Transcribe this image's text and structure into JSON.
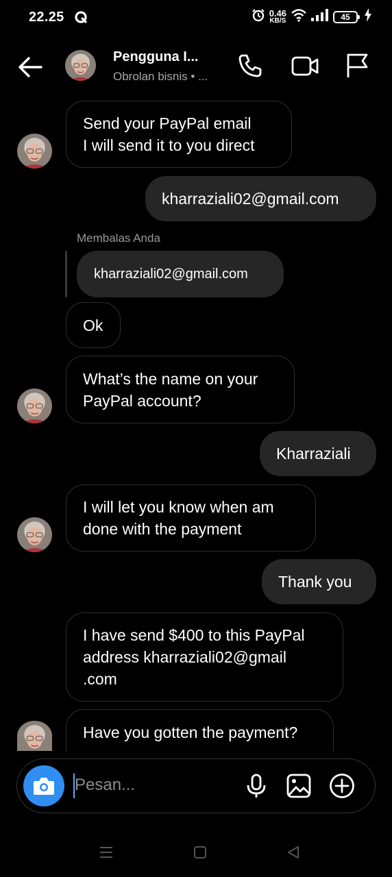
{
  "status_bar": {
    "time": "22.25",
    "net_speed_value": "0.46",
    "net_speed_unit": "KB/S",
    "battery": "45",
    "icons": [
      "q-app-icon",
      "alarm-icon",
      "wifi-icon",
      "signal-icon",
      "battery-icon",
      "charging-icon"
    ]
  },
  "header": {
    "contact_name": "Pengguna I...",
    "subtitle": "Obrolan bisnis • ...",
    "icons": [
      "back-arrow-icon",
      "phone-icon",
      "video-icon",
      "flag-icon"
    ]
  },
  "messages": [
    {
      "from": "them",
      "lines": [
        "Send your PayPal email",
        "I will send it to you direct"
      ]
    },
    {
      "from": "me",
      "lines": [
        "kharraziali02@gmail.com"
      ]
    },
    {
      "from": "them",
      "reply_label": "Membalas Anda",
      "reply_quote": "kharraziali02@gmail.com",
      "lines": [
        "Ok"
      ]
    },
    {
      "from": "them",
      "lines": [
        "What’s the name on your",
        "PayPal account?"
      ]
    },
    {
      "from": "me",
      "lines": [
        "Kharraziali"
      ]
    },
    {
      "from": "them",
      "lines": [
        "I will let you know when am",
        "done with the payment"
      ]
    },
    {
      "from": "me",
      "lines": [
        "Thank you"
      ]
    },
    {
      "from": "them",
      "lines": [
        "I have send $400 to this PayPal",
        "address kharraziali02@gmail",
        ".com"
      ]
    },
    {
      "from": "them",
      "lines": [
        "Have you gotten the payment?"
      ]
    }
  ],
  "composer": {
    "placeholder": "Pesan...",
    "icons": [
      "camera-icon",
      "microphone-icon",
      "gallery-icon",
      "add-icon"
    ]
  },
  "colors": {
    "background": "#000000",
    "outgoing_bubble": "#262626",
    "incoming_border": "#2f2f2f",
    "camera_button": "#2f8ef0",
    "secondary_text": "#a8a8a8"
  }
}
